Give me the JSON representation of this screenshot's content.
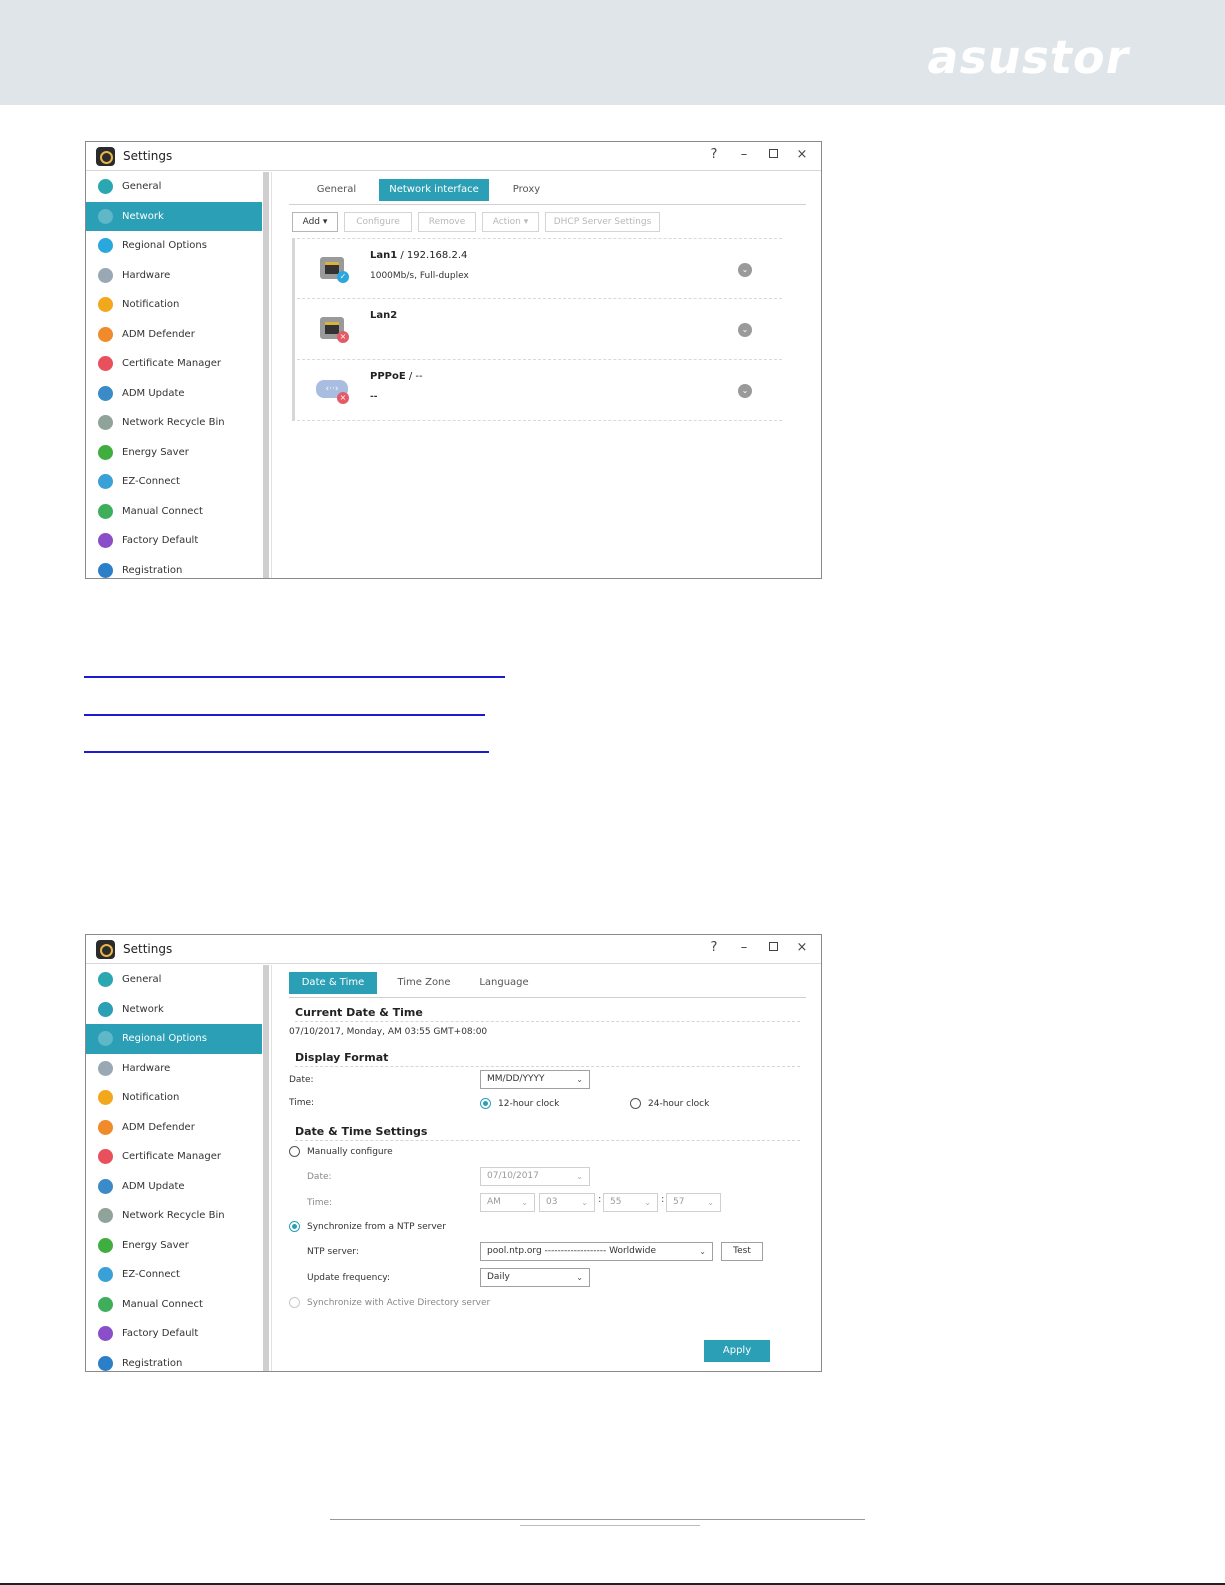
{
  "brand": {
    "logo_text": "asustor"
  },
  "window1": {
    "title": "Settings",
    "controls": {
      "help": "?",
      "minimize": "–",
      "close": "×"
    },
    "sidebar": [
      {
        "label": "General",
        "icon": "general-icon",
        "color": "#2aa7b0"
      },
      {
        "label": "Network",
        "icon": "globe-icon",
        "color": "#2a9fb5",
        "active": true
      },
      {
        "label": "Regional Options",
        "icon": "location-icon",
        "color": "#2aa7dd"
      },
      {
        "label": "Hardware",
        "icon": "hardware-icon",
        "color": "#9aa7b5"
      },
      {
        "label": "Notification",
        "icon": "notification-icon",
        "color": "#f2a81d"
      },
      {
        "label": "ADM Defender",
        "icon": "firewall-icon",
        "color": "#f08a2a"
      },
      {
        "label": "Certificate Manager",
        "icon": "certificate-icon",
        "color": "#e8505b"
      },
      {
        "label": "ADM Update",
        "icon": "update-icon",
        "color": "#3a8bc8"
      },
      {
        "label": "Network Recycle Bin",
        "icon": "recycle-bin-icon",
        "color": "#8fa39a"
      },
      {
        "label": "Energy Saver",
        "icon": "energy-icon",
        "color": "#3fae3f"
      },
      {
        "label": "EZ-Connect",
        "icon": "cloud-icon",
        "color": "#3aa0d8"
      },
      {
        "label": "Manual Connect",
        "icon": "connect-icon",
        "color": "#3fae5a"
      },
      {
        "label": "Factory Default",
        "icon": "undo-icon",
        "color": "#8a4fc8"
      },
      {
        "label": "Registration",
        "icon": "registration-icon",
        "color": "#2a7fc8"
      }
    ],
    "tabs": [
      "General",
      "Network interface",
      "Proxy"
    ],
    "active_tab": 1,
    "toolbar": {
      "add": "Add ▾",
      "configure": "Configure",
      "remove": "Remove",
      "action": "Action ▾",
      "dhcp": "DHCP Server Settings"
    },
    "interfaces": [
      {
        "name": "Lan1",
        "suffix": " / 192.168.2.4",
        "detail": "1000Mb/s, Full-duplex",
        "status": "connected"
      },
      {
        "name": "Lan2",
        "suffix": "",
        "detail": "",
        "status": "disconnected"
      },
      {
        "name": "PPPoE",
        "suffix": " / --",
        "detail": "--",
        "status": "disconnected"
      }
    ]
  },
  "window2": {
    "title": "Settings",
    "sidebar": [
      {
        "label": "General",
        "icon": "general-icon",
        "color": "#2aa7b0"
      },
      {
        "label": "Network",
        "icon": "globe-icon",
        "color": "#2a9fb5"
      },
      {
        "label": "Regional Options",
        "icon": "location-icon",
        "color": "#2aa7dd",
        "active": true
      },
      {
        "label": "Hardware",
        "icon": "hardware-icon",
        "color": "#9aa7b5"
      },
      {
        "label": "Notification",
        "icon": "notification-icon",
        "color": "#f2a81d"
      },
      {
        "label": "ADM Defender",
        "icon": "firewall-icon",
        "color": "#f08a2a"
      },
      {
        "label": "Certificate Manager",
        "icon": "certificate-icon",
        "color": "#e8505b"
      },
      {
        "label": "ADM Update",
        "icon": "update-icon",
        "color": "#3a8bc8"
      },
      {
        "label": "Network Recycle Bin",
        "icon": "recycle-bin-icon",
        "color": "#8fa39a"
      },
      {
        "label": "Energy Saver",
        "icon": "energy-icon",
        "color": "#3fae3f"
      },
      {
        "label": "EZ-Connect",
        "icon": "cloud-icon",
        "color": "#3aa0d8"
      },
      {
        "label": "Manual Connect",
        "icon": "connect-icon",
        "color": "#3fae5a"
      },
      {
        "label": "Factory Default",
        "icon": "undo-icon",
        "color": "#8a4fc8"
      },
      {
        "label": "Registration",
        "icon": "registration-icon",
        "color": "#2a7fc8"
      }
    ],
    "tabs": [
      "Date & Time",
      "Time Zone",
      "Language"
    ],
    "active_tab": 0,
    "current": {
      "heading": "Current Date & Time",
      "value": "07/10/2017, Monday, AM 03:55 GMT+08:00"
    },
    "display_format": {
      "heading": "Display Format",
      "date_label": "Date:",
      "date_value": "MM/DD/YYYY",
      "time_label": "Time:",
      "opt_12": "12-hour clock",
      "opt_24": "24-hour clock",
      "selected": "12"
    },
    "settings": {
      "heading": "Date & Time Settings",
      "manual": "Manually configure",
      "date_label": "Date:",
      "date_value": "07/10/2017",
      "time_label": "Time:",
      "ampm": "AM",
      "hour": "03",
      "minute": "55",
      "second": "57",
      "ntp_option": "Synchronize from a NTP server",
      "ntp_label": "NTP server:",
      "ntp_value": "pool.ntp.org ------------------- Worldwide",
      "test": "Test",
      "freq_label": "Update frequency:",
      "freq_value": "Daily",
      "ad_option": "Synchronize with Active Directory server",
      "selected": "ntp"
    },
    "apply": "Apply"
  }
}
